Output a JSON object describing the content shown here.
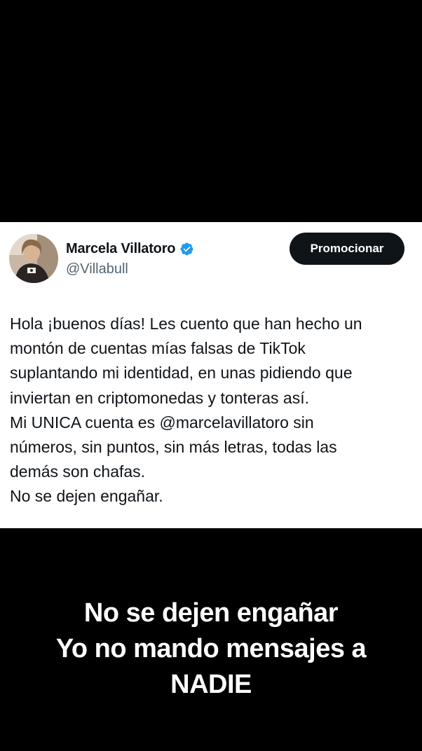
{
  "tweet": {
    "author": {
      "display_name": "Marcela Villatoro",
      "username": "@Villabull",
      "verified": true,
      "avatar_icon": "profile-photo-icon"
    },
    "promote_label": "Promocionar",
    "lines": [
      "Hola ¡buenos días! Les cuento que han hecho un",
      "montón de cuentas mías falsas de TikTok",
      "suplantando mi identidad, en unas pidiendo que",
      "inviertan en criptomonedas y tonteras así.",
      "Mi UNICA cuenta es @marcelavillatoro sin",
      "números, sin puntos, sin más letras, todas las",
      "demás son chafas.",
      "No se dejen engañar."
    ]
  },
  "caption": {
    "lines": [
      "No se dejen engañar",
      "Yo no mando mensajes a",
      "NADIE"
    ]
  },
  "colors": {
    "background": "#000000",
    "card": "#ffffff",
    "text_primary": "#0f1419",
    "text_secondary": "#536471",
    "verified_blue": "#1d9bf0",
    "button_bg": "#0f1419",
    "caption_text": "#ffffff"
  }
}
